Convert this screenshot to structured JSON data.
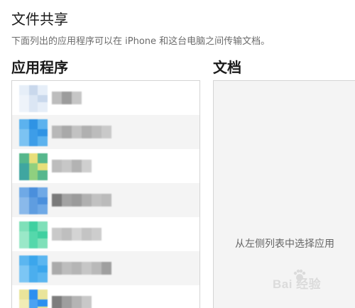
{
  "page": {
    "section_title": "文件共享",
    "description": "下面列出的应用程序可以在 iPhone 和这台电脑之间传输文档。"
  },
  "apps_panel": {
    "header": "应用程序",
    "rows": [
      {
        "icon_colors": [
          "#e6eef8",
          "#c9d8ec",
          "#eef3fa",
          "#dbe6f4"
        ],
        "name_colors": [
          "#bdbdbd",
          "#9c9c9c",
          "#c6c6c6"
        ],
        "alt": false
      },
      {
        "icon_colors": [
          "#5cb2ee",
          "#2f93e4",
          "#7cc3f2",
          "#3d9de8"
        ],
        "name_colors": [
          "#b8b8b8",
          "#a9a9a9",
          "#c2c2c2",
          "#b0b0b0",
          "#bcbcbc",
          "#c9c9c9"
        ],
        "alt": true
      },
      {
        "icon_colors": [
          "#56b78c",
          "#e8df7a",
          "#3fa6a0",
          "#8fd07f"
        ],
        "name_colors": [
          "#bdbdbd",
          "#c7c7c7",
          "#b3b3b3",
          "#cfcfcf"
        ],
        "alt": false
      },
      {
        "icon_colors": [
          "#6fa9e6",
          "#4a8fdc",
          "#8ab9ea",
          "#5f9de0"
        ],
        "name_colors": [
          "#7a7a7a",
          "#a3a3a3",
          "#9b9b9b",
          "#b0b0b0",
          "#c1c1c1",
          "#bbbbbb"
        ],
        "alt": true
      },
      {
        "icon_colors": [
          "#7fe0b9",
          "#3fd0a0",
          "#9ae8c8",
          "#55d8ab"
        ],
        "name_colors": [
          "#c9c9c9",
          "#bfbfbf",
          "#d4d4d4",
          "#c4c4c4",
          "#cdcdcd"
        ],
        "alt": false
      },
      {
        "icon_colors": [
          "#5bb6f0",
          "#3ba6ec",
          "#7cc6f4",
          "#4baeee"
        ],
        "name_colors": [
          "#aaaaaa",
          "#bdbdbd",
          "#b5b5b5",
          "#c6c6c6",
          "#b9b9b9",
          "#9f9f9f"
        ],
        "alt": true
      },
      {
        "icon_colors": [
          "#e9e49a",
          "#2b8ff0",
          "#f1ecb5",
          "#4aa2f2"
        ],
        "name_colors": [
          "#7d7d7d",
          "#9e9e9e",
          "#b4b4b4",
          "#c8c8c8"
        ],
        "alt": false
      }
    ]
  },
  "docs_panel": {
    "header": "文档",
    "hint": "从左侧列表中选择应用"
  },
  "watermark": {
    "text": "Bai  经验"
  }
}
